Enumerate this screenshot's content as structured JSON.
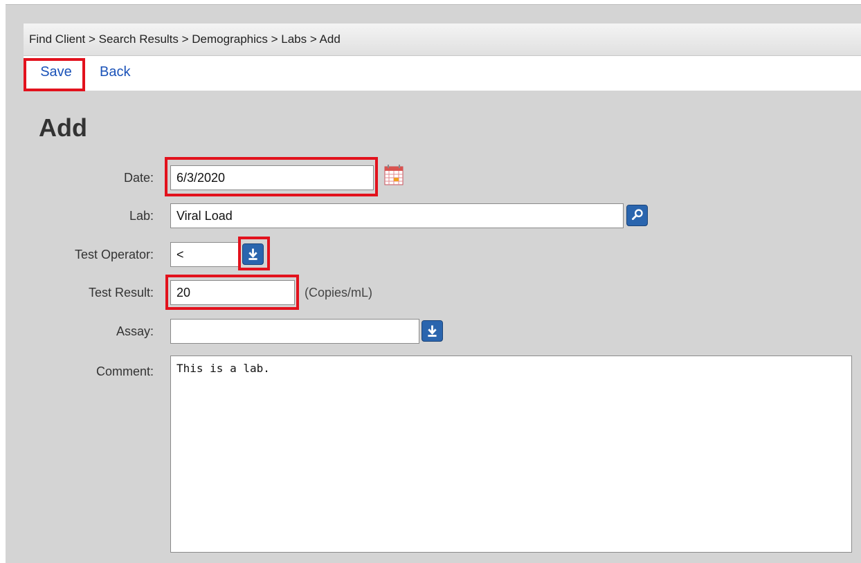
{
  "breadcrumb": "Find Client > Search Results > Demographics > Labs > Add",
  "actions": {
    "save": "Save",
    "back": "Back"
  },
  "page_title": "Add",
  "form": {
    "date": {
      "label": "Date:",
      "value": "6/3/2020"
    },
    "lab": {
      "label": "Lab:",
      "value": "Viral Load"
    },
    "test_operator": {
      "label": "Test Operator:",
      "value": "<"
    },
    "test_result": {
      "label": "Test Result:",
      "value": "20",
      "unit": "(Copies/mL)"
    },
    "assay": {
      "label": "Assay:",
      "value": ""
    },
    "comment": {
      "label": "Comment:",
      "value": "This is a lab."
    }
  },
  "colors": {
    "highlight": "#e2121d",
    "link": "#1a52b8",
    "icon_button": "#2a65ae"
  },
  "icons": [
    "calendar-icon",
    "search-icon",
    "download-icon"
  ]
}
